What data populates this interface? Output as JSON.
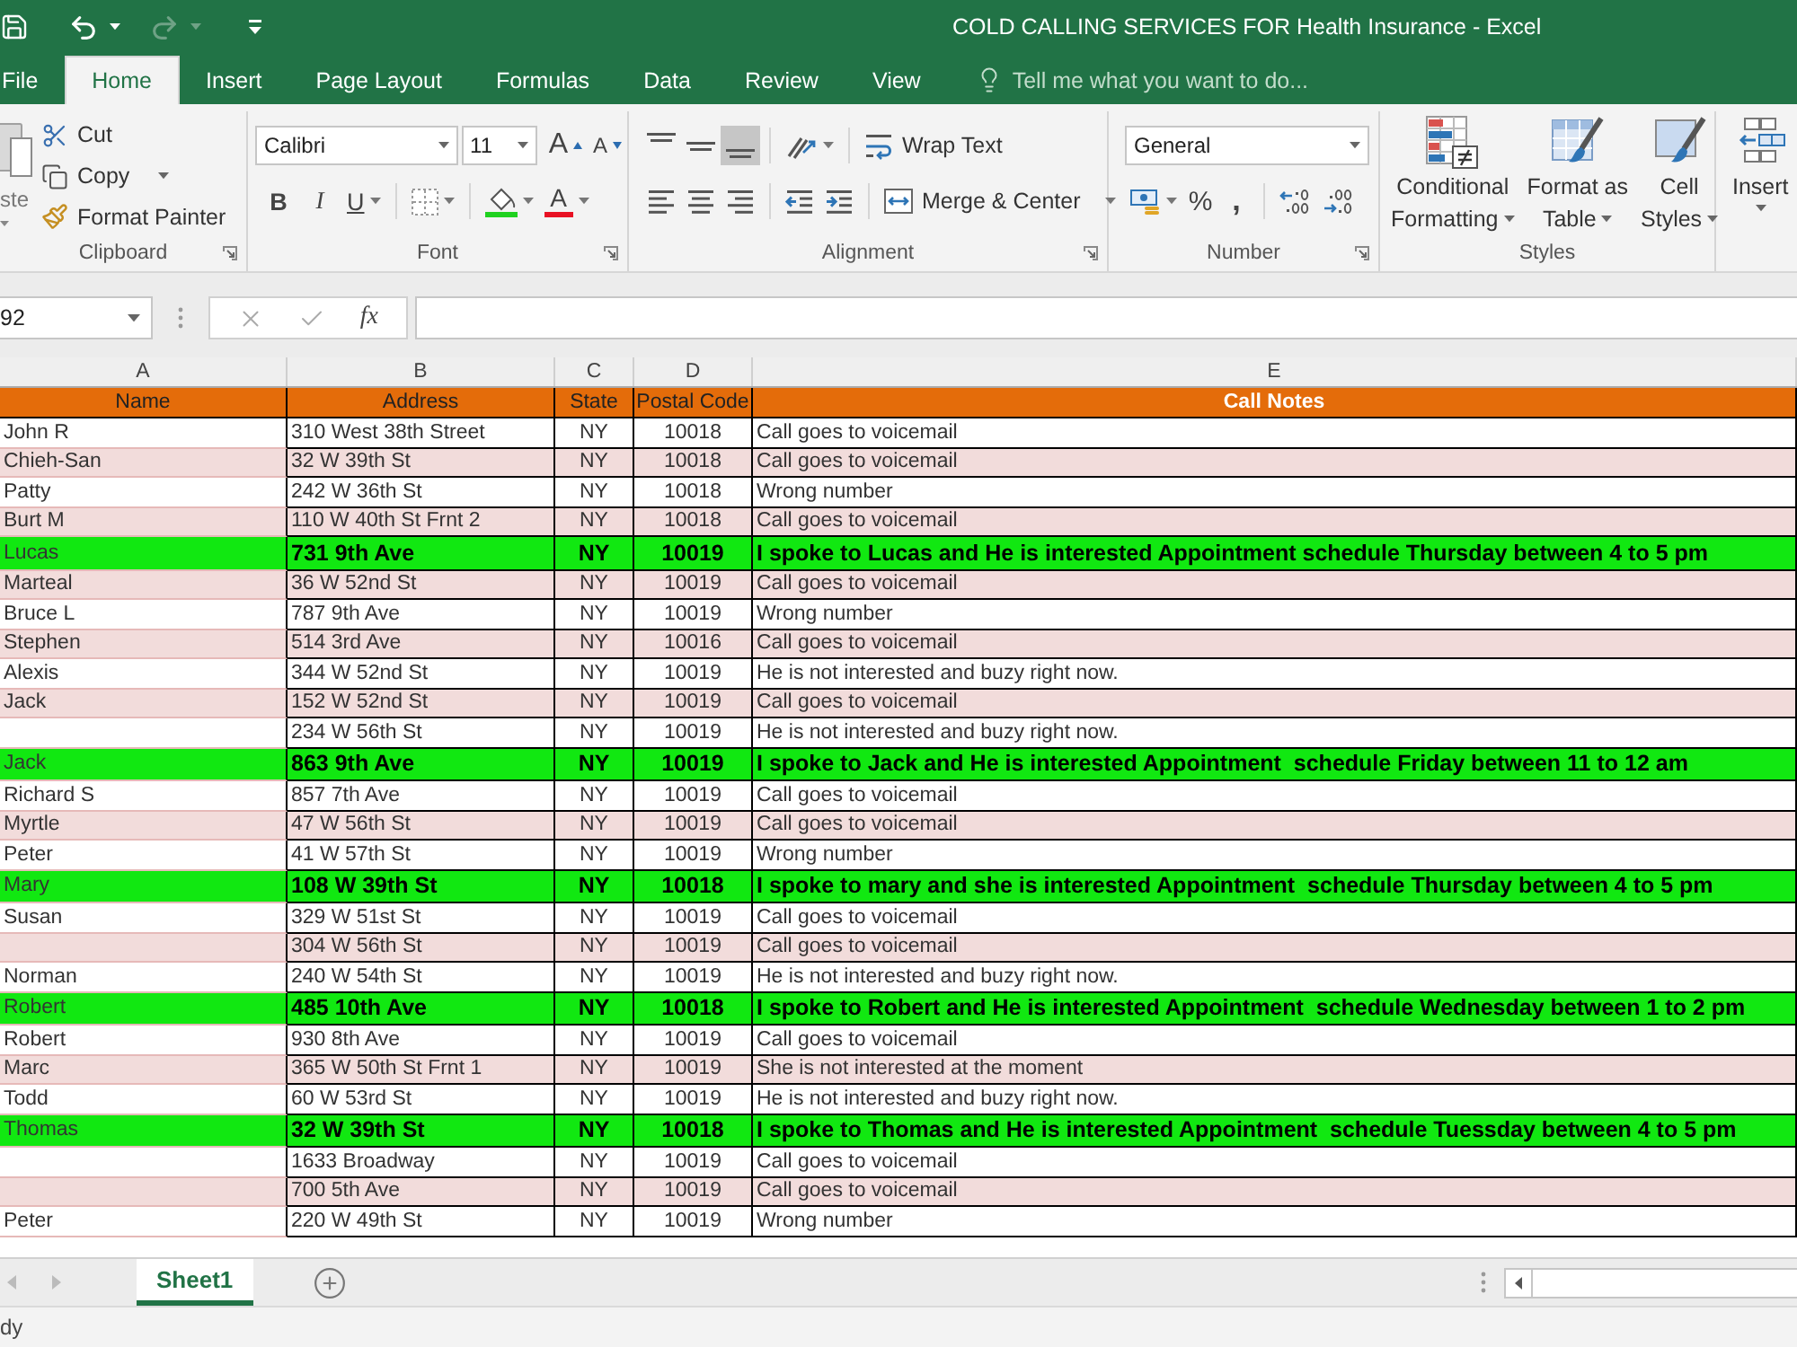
{
  "title_bar": {
    "title": "COLD CALLING SERVICES FOR Health Insurance - Excel"
  },
  "tabs": [
    {
      "label": "File",
      "selected": false
    },
    {
      "label": "Home",
      "selected": true
    },
    {
      "label": "Insert",
      "selected": false
    },
    {
      "label": "Page Layout",
      "selected": false
    },
    {
      "label": "Formulas",
      "selected": false
    },
    {
      "label": "Data",
      "selected": false
    },
    {
      "label": "Review",
      "selected": false
    },
    {
      "label": "View",
      "selected": false
    }
  ],
  "tell_me": {
    "placeholder": "Tell me what you want to do..."
  },
  "ribbon": {
    "clipboard": {
      "label": "Clipboard",
      "paste": "ste",
      "buttons": [
        {
          "kind": "cut",
          "label": "Cut",
          "dropdown": false
        },
        {
          "kind": "copy",
          "label": "Copy",
          "dropdown": true
        },
        {
          "kind": "format_painter",
          "label": "Format Painter",
          "dropdown": false
        }
      ]
    },
    "font": {
      "label": "Font",
      "font_name": "Calibri",
      "font_size": "11",
      "grow": "A",
      "shrink": "A",
      "format_buttons": [
        {
          "kind": "bold",
          "label": "B",
          "dropdown": false
        },
        {
          "kind": "italic",
          "label": "I",
          "dropdown": false
        },
        {
          "kind": "underline",
          "label": "U",
          "dropdown": true
        }
      ],
      "font_color": "A"
    },
    "alignment": {
      "label": "Alignment",
      "vertical_align": [
        {
          "kind": "top",
          "selected": false
        },
        {
          "kind": "middle",
          "selected": false
        },
        {
          "kind": "bottom",
          "selected": true
        }
      ],
      "wrap_text": "Wrap Text",
      "merge_center": "Merge & Center"
    },
    "number": {
      "label": "Number",
      "format": "General",
      "percent": "%",
      "comma": ","
    },
    "styles": {
      "label": "Styles",
      "buttons": [
        {
          "kind": "conditional",
          "lines": [
            "Conditional",
            "Formatting"
          ]
        },
        {
          "kind": "table",
          "lines": [
            "Format as",
            "Table"
          ]
        },
        {
          "kind": "cell",
          "lines": [
            "Cell",
            "Styles"
          ]
        }
      ]
    },
    "cells": {
      "insert": "Insert"
    }
  },
  "formula_bar": {
    "name_box": "92",
    "function_label": "fx"
  },
  "columns": [
    "A",
    "B",
    "C",
    "D",
    "E"
  ],
  "table": {
    "headers": [
      {
        "label": "Name",
        "bold": false
      },
      {
        "label": "Address",
        "bold": false
      },
      {
        "label": "State",
        "bold": false
      },
      {
        "label": "Postal Code",
        "bold": false
      },
      {
        "label": "Call Notes",
        "bold": true
      }
    ],
    "rows": [
      {
        "name": "John R",
        "address": "310 West 38th Street",
        "state": "NY",
        "postal_code": "10018",
        "notes": "Call goes to voicemail",
        "color": "#ffffff",
        "bold": false
      },
      {
        "name": "Chieh-San",
        "address": "32 W 39th St",
        "state": "NY",
        "postal_code": "10018",
        "notes": "Call goes to voicemail",
        "color": "#f2dcdb",
        "bold": false
      },
      {
        "name": "Patty",
        "address": "242 W 36th St",
        "state": "NY",
        "postal_code": "10018",
        "notes": "Wrong number",
        "color": "#ffffff",
        "bold": false
      },
      {
        "name": "Burt M",
        "address": "110 W 40th St Frnt 2",
        "state": "NY",
        "postal_code": "10018",
        "notes": "Call goes to voicemail",
        "color": "#f2dcdb",
        "bold": false
      },
      {
        "name": "Lucas",
        "address": "731 9th Ave",
        "state": "NY",
        "postal_code": "10019",
        "notes": "I spoke to Lucas and He is interested Appointment schedule Thursday between 4 to 5 pm",
        "color": "#11e811",
        "bold": true
      },
      {
        "name": "Marteal",
        "address": "36 W 52nd St",
        "state": "NY",
        "postal_code": "10019",
        "notes": "Call goes to voicemail",
        "color": "#f2dcdb",
        "bold": false
      },
      {
        "name": "Bruce L",
        "address": "787 9th Ave",
        "state": "NY",
        "postal_code": "10019",
        "notes": "Wrong number",
        "color": "#ffffff",
        "bold": false
      },
      {
        "name": "Stephen",
        "address": "514 3rd Ave",
        "state": "NY",
        "postal_code": "10016",
        "notes": "Call goes to voicemail",
        "color": "#f2dcdb",
        "bold": false
      },
      {
        "name": "Alexis",
        "address": "344 W 52nd St",
        "state": "NY",
        "postal_code": "10019",
        "notes": "He is not interested and buzy right now.",
        "color": "#ffffff",
        "bold": false
      },
      {
        "name": "Jack",
        "address": "152 W 52nd St",
        "state": "NY",
        "postal_code": "10019",
        "notes": "Call goes to voicemail",
        "color": "#f2dcdb",
        "bold": false
      },
      {
        "address": "234 W 56th St",
        "state": "NY",
        "postal_code": "10019",
        "notes": "He is not interested and buzy right now.",
        "color": "#ffffff",
        "bold": false
      },
      {
        "name": "Jack",
        "address": "863 9th Ave",
        "state": "NY",
        "postal_code": "10019",
        "notes": "I spoke to Jack and He is interested Appointment  schedule Friday between 11 to 12 am",
        "color": "#11e811",
        "bold": true
      },
      {
        "name": "Richard S",
        "address": "857 7th Ave",
        "state": "NY",
        "postal_code": "10019",
        "notes": "Call goes to voicemail",
        "color": "#ffffff",
        "bold": false
      },
      {
        "name": "Myrtle",
        "address": "47 W 56th St",
        "state": "NY",
        "postal_code": "10019",
        "notes": "Call goes to voicemail",
        "color": "#f2dcdb",
        "bold": false
      },
      {
        "name": "Peter",
        "address": "41 W 57th St",
        "state": "NY",
        "postal_code": "10019",
        "notes": "Wrong number",
        "color": "#ffffff",
        "bold": false
      },
      {
        "name": "Mary",
        "address": "108 W 39th St",
        "state": "NY",
        "postal_code": "10018",
        "notes": "I spoke to mary and she is interested Appointment  schedule Thursday between 4 to 5 pm",
        "color": "#11e811",
        "bold": true
      },
      {
        "name": "Susan",
        "address": "329 W 51st St",
        "state": "NY",
        "postal_code": "10019",
        "notes": "Call goes to voicemail",
        "color": "#ffffff",
        "bold": false
      },
      {
        "address": "304 W 56th St",
        "state": "NY",
        "postal_code": "10019",
        "notes": "Call goes to voicemail",
        "color": "#f2dcdb",
        "bold": false
      },
      {
        "name": "Norman",
        "address": "240 W 54th St",
        "state": "NY",
        "postal_code": "10019",
        "notes": "He is not interested and buzy right now.",
        "color": "#ffffff",
        "bold": false
      },
      {
        "name": "Robert",
        "address": "485 10th Ave",
        "state": "NY",
        "postal_code": "10018",
        "notes": "I spoke to Robert and He is interested Appointment  schedule Wednesday between 1 to 2 pm",
        "color": "#11e811",
        "bold": true
      },
      {
        "name": "Robert",
        "address": "930 8th Ave",
        "state": "NY",
        "postal_code": "10019",
        "notes": "Call goes to voicemail",
        "color": "#ffffff",
        "bold": false
      },
      {
        "name": "Marc",
        "address": "365 W 50th St Frnt 1",
        "state": "NY",
        "postal_code": "10019",
        "notes": "She is not interested at the moment",
        "color": "#f2dcdb",
        "bold": false
      },
      {
        "name": "Todd",
        "address": "60 W 53rd St",
        "state": "NY",
        "postal_code": "10019",
        "notes": "He is not interested and buzy right now.",
        "color": "#ffffff",
        "bold": false
      },
      {
        "name": "Thomas",
        "address": "32 W 39th St",
        "state": "NY",
        "postal_code": "10018",
        "notes": "I spoke to Thomas and He is interested Appointment  schedule Tuessday between 4 to 5 pm",
        "color": "#11e811",
        "bold": true
      },
      {
        "address": "1633 Broadway",
        "state": "NY",
        "postal_code": "10019",
        "notes": "Call goes to voicemail",
        "color": "#ffffff",
        "bold": false
      },
      {
        "address": "700 5th Ave",
        "state": "NY",
        "postal_code": "10019",
        "notes": "Call goes to voicemail",
        "color": "#f2dcdb",
        "bold": false
      },
      {
        "name": "Peter",
        "address": "220 W 49th St",
        "state": "NY",
        "postal_code": "10019",
        "notes": "Wrong number",
        "color": "#ffffff",
        "bold": false
      }
    ]
  },
  "sheet_tabs": [
    {
      "label": "Sheet1",
      "selected": true
    }
  ],
  "status_bar": {
    "text": "dy"
  }
}
